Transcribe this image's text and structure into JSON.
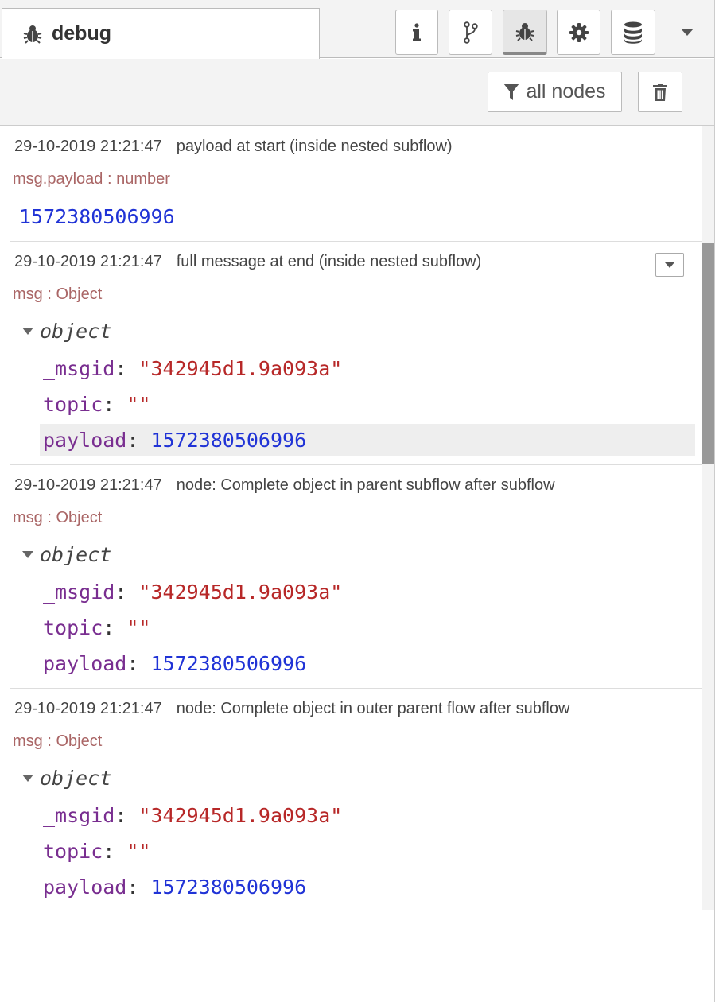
{
  "sidebar_tab": {
    "label": "debug",
    "icon": "bug-icon"
  },
  "tab_buttons": [
    {
      "name": "info",
      "icon": "info-icon",
      "active": false
    },
    {
      "name": "changes",
      "icon": "branch-icon",
      "active": false
    },
    {
      "name": "debug",
      "icon": "bug-icon",
      "active": true
    },
    {
      "name": "config",
      "icon": "gear-icon",
      "active": false
    },
    {
      "name": "context",
      "icon": "database-icon",
      "active": false
    }
  ],
  "toolbar": {
    "filter_label": "all nodes",
    "filter_icon": "filter-icon",
    "clear_icon": "trash-icon"
  },
  "messages": [
    {
      "timestamp": "29-10-2019 21:21:47",
      "name": "payload at start (inside nested subflow)",
      "type": "msg.payload : number",
      "value": "1572380506996"
    },
    {
      "timestamp": "29-10-2019 21:21:47",
      "name": "full message at end (inside nested subflow)",
      "type": "msg : Object",
      "object_label": "object",
      "props": [
        {
          "key": "_msgid",
          "value": "\"342945d1.9a093a\"",
          "kind": "string"
        },
        {
          "key": "topic",
          "value": "\"\"",
          "kind": "string"
        },
        {
          "key": "payload",
          "value": "1572380506996",
          "kind": "number"
        }
      ]
    },
    {
      "timestamp": "29-10-2019 21:21:47",
      "name": "node: Complete object in parent subflow after subflow",
      "type": "msg : Object",
      "object_label": "object",
      "props": [
        {
          "key": "_msgid",
          "value": "\"342945d1.9a093a\"",
          "kind": "string"
        },
        {
          "key": "topic",
          "value": "\"\"",
          "kind": "string"
        },
        {
          "key": "payload",
          "value": "1572380506996",
          "kind": "number"
        }
      ]
    },
    {
      "timestamp": "29-10-2019 21:21:47",
      "name": "node: Complete object in outer parent flow after subflow",
      "type": "msg : Object",
      "object_label": "object",
      "props": [
        {
          "key": "_msgid",
          "value": "\"342945d1.9a093a\"",
          "kind": "string"
        },
        {
          "key": "topic",
          "value": "\"\"",
          "kind": "string"
        },
        {
          "key": "payload",
          "value": "1572380506996",
          "kind": "number"
        }
      ]
    }
  ],
  "colors": {
    "type_label": "#a66666",
    "key": "#792e90",
    "string": "#b72828",
    "number": "#2033d6"
  }
}
